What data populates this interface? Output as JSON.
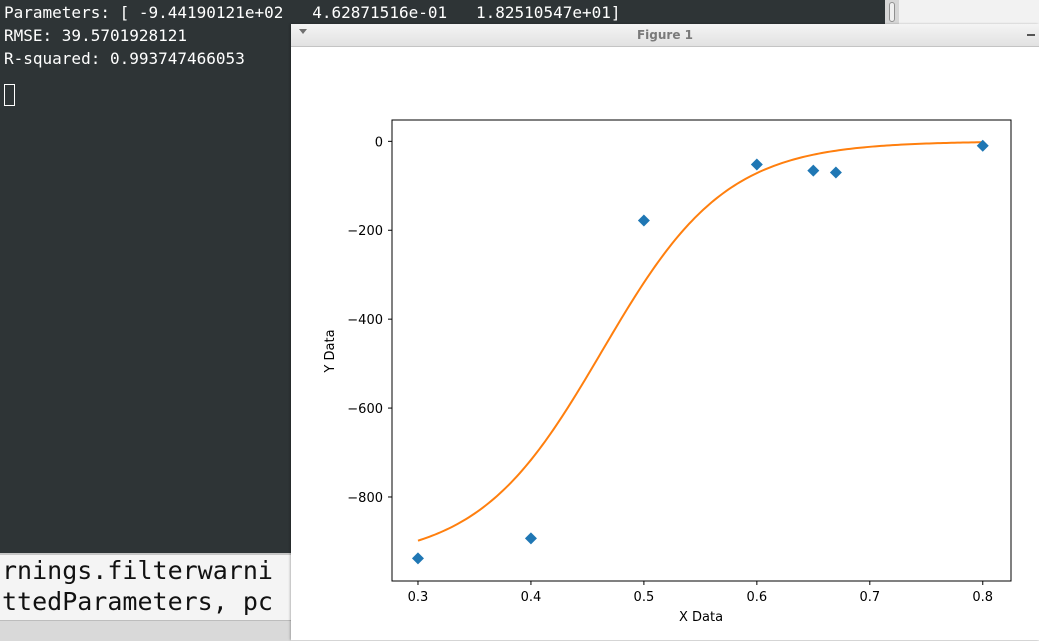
{
  "terminal": {
    "lines": [
      "Parameters: [ -9.44190121e+02   4.62871516e-01   1.82510547e+01]",
      "RMSE: 39.5701928121",
      "R-squared: 0.993747466053"
    ]
  },
  "editor": {
    "lines": [
      "rnings.filterwarni",
      "ttedParameters, pc"
    ]
  },
  "figure": {
    "title": "Figure 1"
  },
  "chart_data": {
    "type": "scatter",
    "xlabel": "X Data",
    "ylabel": "Y Data",
    "xlim": [
      0.277,
      0.825
    ],
    "ylim": [
      -989,
      48
    ],
    "xticks": [
      0.3,
      0.4,
      0.5,
      0.6,
      0.7,
      0.8
    ],
    "xtick_labels": [
      "0.3",
      "0.4",
      "0.5",
      "0.6",
      "0.7",
      "0.8"
    ],
    "yticks": [
      0,
      -200,
      -400,
      -600,
      -800
    ],
    "ytick_labels": [
      "0",
      "−200",
      "−400",
      "−600",
      "−800"
    ],
    "grid": false,
    "series": [
      {
        "type": "scatter",
        "marker": "diamond",
        "color": "#1f77b4",
        "x": [
          0.3,
          0.4,
          0.5,
          0.6,
          0.65,
          0.67,
          0.8
        ],
        "y": [
          -938,
          -893,
          -178,
          -52,
          -66,
          -70,
          -10
        ]
      },
      {
        "type": "line",
        "color": "#ff7f0e",
        "model": "sigmoid",
        "parameters": [
          -944.190121,
          0.462871516,
          18.2510547
        ],
        "x_range": [
          0.3,
          0.8
        ]
      }
    ]
  }
}
